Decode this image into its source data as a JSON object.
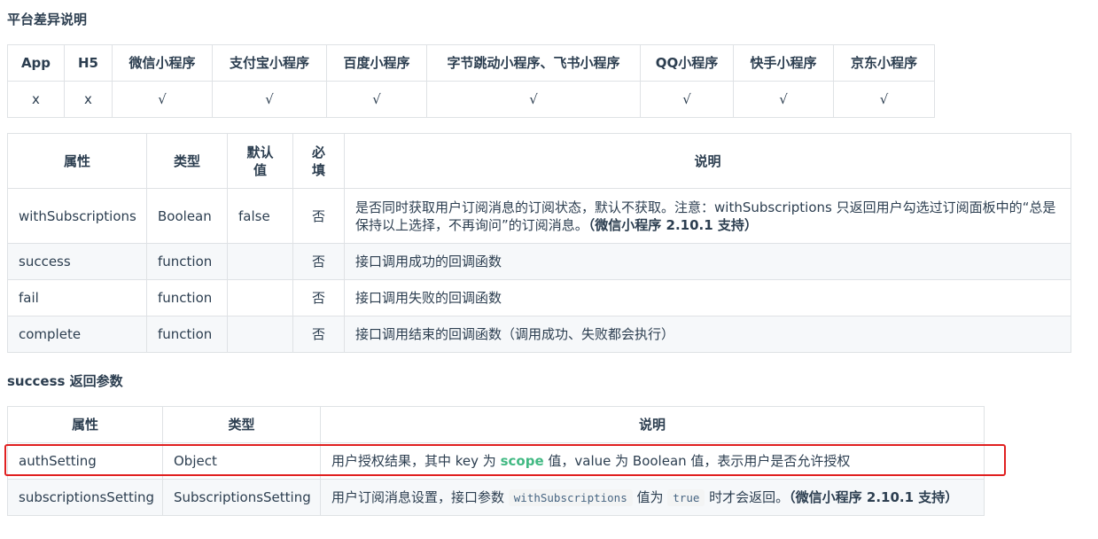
{
  "platform_section": {
    "title": "平台差异说明",
    "headers": [
      "App",
      "H5",
      "微信小程序",
      "支付宝小程序",
      "百度小程序",
      "字节跳动小程序、飞书小程序",
      "QQ小程序",
      "快手小程序",
      "京东小程序"
    ],
    "values": [
      "x",
      "x",
      "√",
      "√",
      "√",
      "√",
      "√",
      "√",
      "√"
    ]
  },
  "params_table": {
    "headers": {
      "name": "属性",
      "type": "类型",
      "default_line1": "默认",
      "default_line2": "值",
      "required_line1": "必",
      "required_line2": "填",
      "desc": "说明"
    },
    "rows": [
      {
        "name": "withSubscriptions",
        "type": "Boolean",
        "default": "false",
        "required": "否",
        "desc": "是否同时获取用户订阅消息的订阅状态，默认不获取。注意：withSubscriptions 只返回用户勾选过订阅面板中的“总是保持以上选择，不再询问”的订阅消息。",
        "desc_strong": "（微信小程序 2.10.1 支持）"
      },
      {
        "name": "success",
        "type": "function",
        "default": "",
        "required": "否",
        "desc": "接口调用成功的回调函数"
      },
      {
        "name": "fail",
        "type": "function",
        "default": "",
        "required": "否",
        "desc": "接口调用失败的回调函数"
      },
      {
        "name": "complete",
        "type": "function",
        "default": "",
        "required": "否",
        "desc": "接口调用结束的回调函数（调用成功、失败都会执行）"
      }
    ]
  },
  "success_section": {
    "title": "success 返回参数",
    "headers": {
      "name": "属性",
      "type": "类型",
      "desc": "说明"
    },
    "rows": [
      {
        "name": "authSetting",
        "type": "Object",
        "desc_part1": "用户授权结果，其中 key 为 ",
        "desc_highlight": "scope",
        "desc_part2": " 值，value 为 Boolean 值，表示用户是否允许授权"
      },
      {
        "name": "subscriptionsSetting",
        "type": "SubscriptionsSetting",
        "desc_part1": "用户订阅消息设置，接口参数 ",
        "desc_code1": "withSubscriptions",
        "desc_part2": " 值为 ",
        "desc_code2": "true",
        "desc_part3": " 时才会返回。",
        "desc_strong": "（微信小程序 2.10.1 支持）"
      }
    ]
  },
  "colors": {
    "highlight_box": "#e02020",
    "scope_text": "#42b983",
    "border": "#dfe2e5",
    "stripe": "#f6f8fa"
  }
}
